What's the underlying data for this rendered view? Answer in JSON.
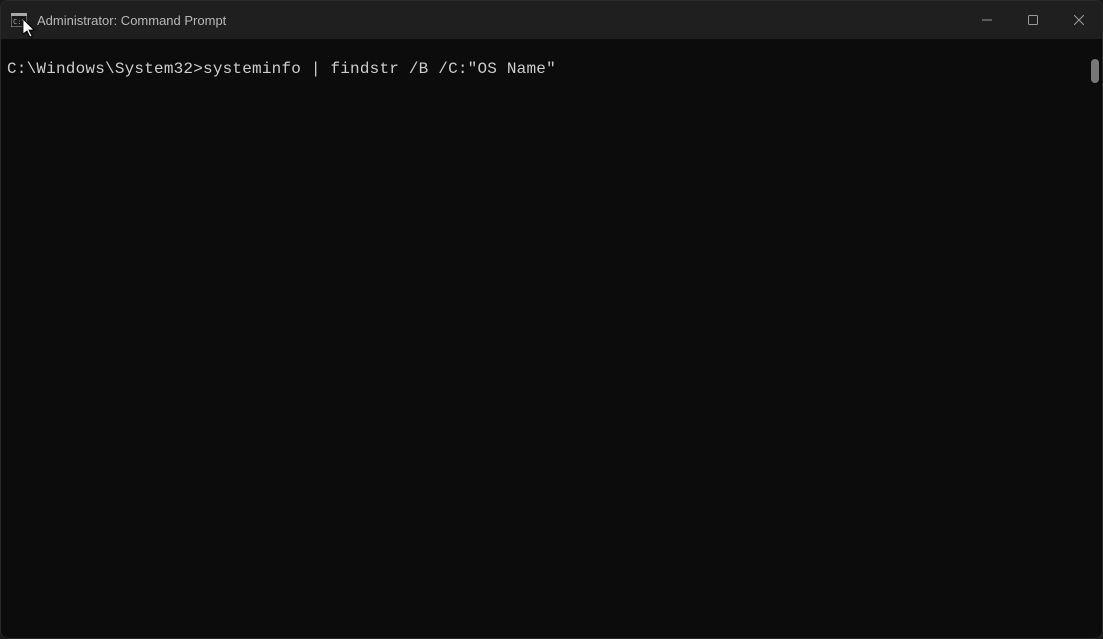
{
  "titlebar": {
    "title": "Administrator: Command Prompt"
  },
  "terminal": {
    "prompt": "C:\\Windows\\System32>",
    "command": "systeminfo | findstr /B /C:\"OS Name\""
  }
}
